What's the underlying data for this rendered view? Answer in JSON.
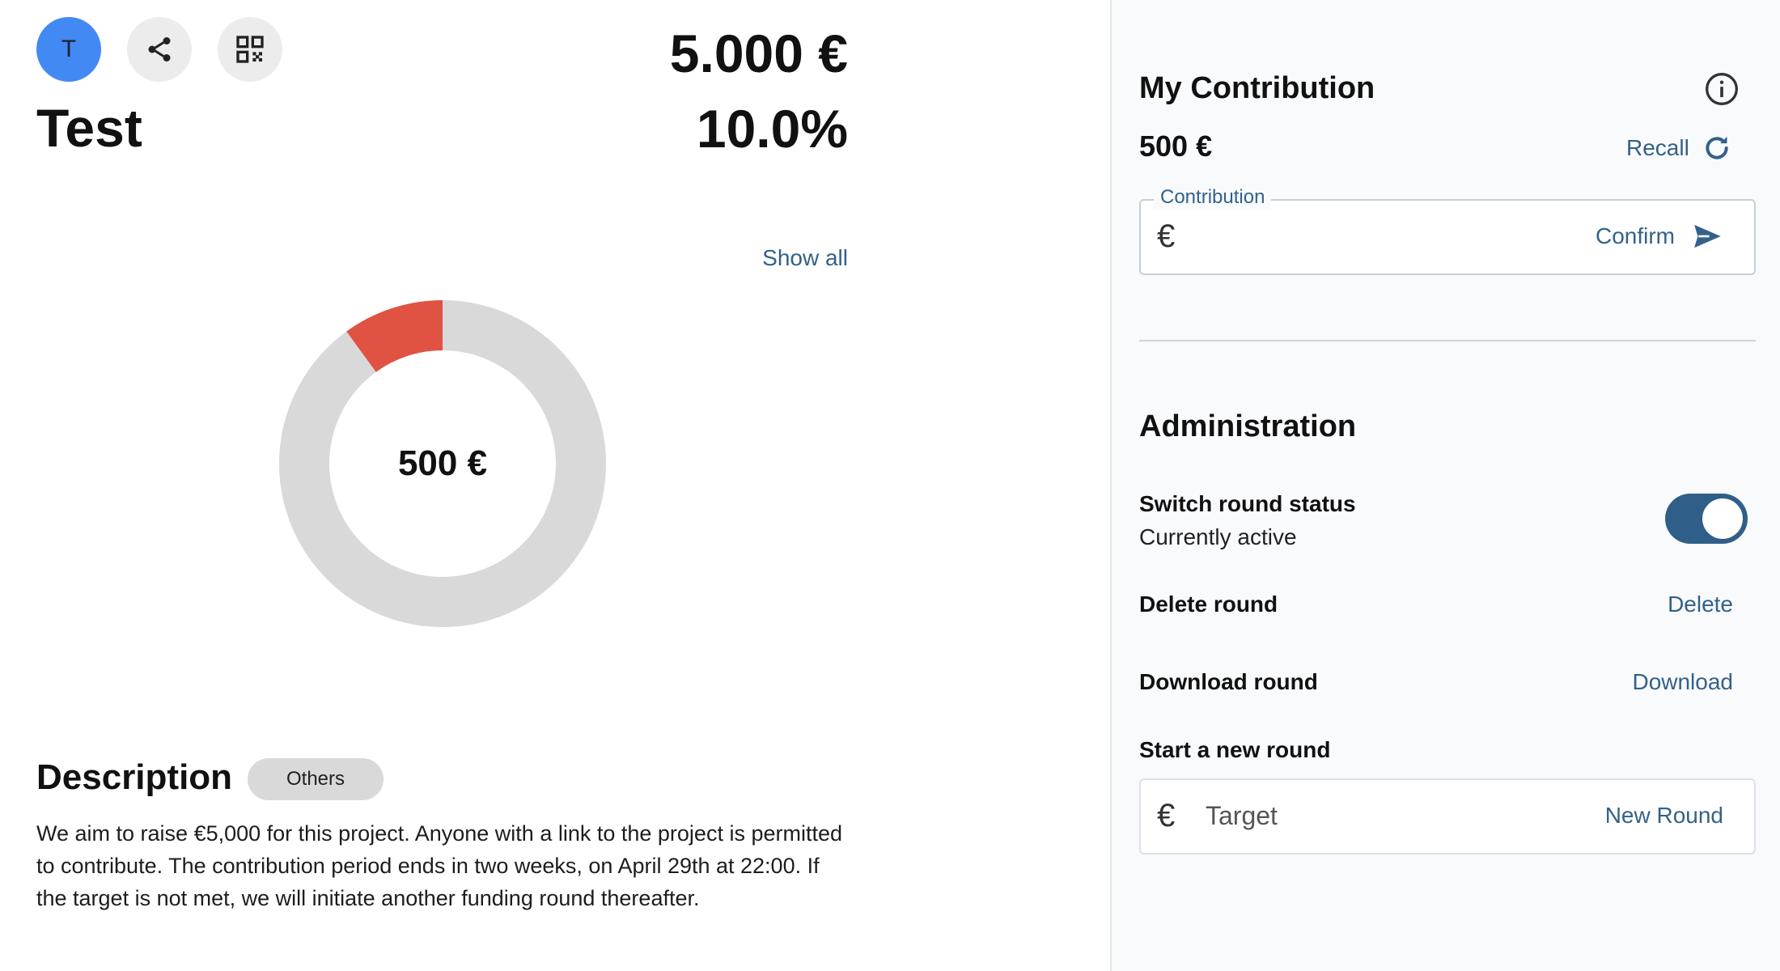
{
  "round": {
    "avatar_letter": "T",
    "title": "Test",
    "target_amount": "5.000 €",
    "percentage": "10.0%",
    "show_all_label": "Show all",
    "raised_label": "500 €",
    "progress_fraction": 0.1
  },
  "colors": {
    "accent": "#33618a",
    "avatar_bg": "#4389f3",
    "donut_fill": "#e05343",
    "donut_track": "#d9d9d9",
    "toggle_on": "#2f5f88"
  },
  "description": {
    "heading": "Description",
    "category_chip": "Others",
    "text": "We aim to raise €5,000 for this project. Anyone with a link to the project is permitted to contribute. The contribution period ends in two weeks, on April 29th at 22:00. If the target is not met, we will initiate another funding round thereafter."
  },
  "contribution": {
    "heading": "My Contribution",
    "amount": "500 €",
    "recall_label": "Recall",
    "field_label": "Contribution",
    "currency_symbol": "€",
    "confirm_label": "Confirm"
  },
  "administration": {
    "heading": "Administration",
    "switch_label": "Switch round status",
    "switch_status": "Currently active",
    "switch_on": true,
    "delete_label": "Delete round",
    "delete_action": "Delete",
    "download_label": "Download round",
    "download_action": "Download",
    "new_round_label": "Start a new round",
    "target_placeholder": "Target",
    "new_round_action": "New Round",
    "currency_symbol": "€"
  },
  "icons": {
    "share": "share-icon",
    "qr": "qr-code-icon",
    "info": "info-icon",
    "recall": "refresh-icon",
    "confirm": "send-icon"
  }
}
